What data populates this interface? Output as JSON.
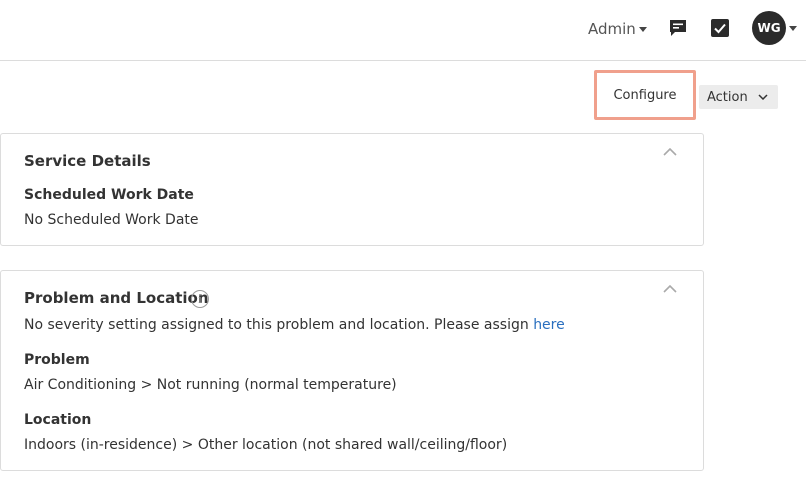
{
  "header": {
    "admin_label": "Admin",
    "avatar_initials": "WG"
  },
  "toolbar": {
    "configure_label": "Configure",
    "action_label": "Action"
  },
  "service_details": {
    "title": "Service Details",
    "scheduled_label": "Scheduled Work Date",
    "scheduled_value": "No Scheduled Work Date"
  },
  "problem_location": {
    "title": "Problem and Location",
    "severity_notice": "No severity setting assigned to this problem and location. Please assign ",
    "assign_link": "here",
    "problem_label": "Problem",
    "problem_value": "Air Conditioning > Not running (normal temperature)",
    "location_label": "Location",
    "location_value": "Indoors (in-residence) > Other location (not shared wall/ceiling/floor)"
  },
  "colors": {
    "highlight_border": "#f0a08c",
    "link": "#2a6fbf",
    "avatar_bg": "#2b2b2b"
  },
  "icons": [
    "chat-icon",
    "checkbox-icon",
    "chevron-down-icon",
    "chevron-up-icon",
    "info-icon"
  ]
}
